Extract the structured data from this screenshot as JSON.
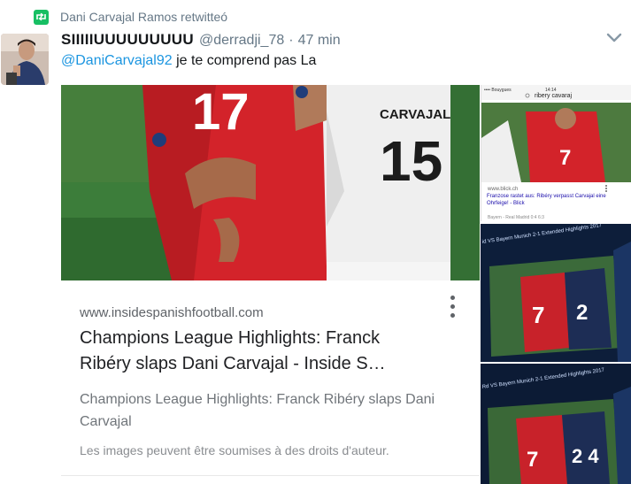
{
  "retweet": {
    "text": "Dani Carvajal Ramos retwitteó"
  },
  "tweet": {
    "name": "SIIIIIUUUUUUUUU",
    "handle": "@derradji_78",
    "separator": "·",
    "time": "47 min",
    "mention": "@DaniCarvajal92",
    "text": " je te comprend pas La"
  },
  "card": {
    "photo_jersey_number_left": "17",
    "photo_jersey_name": "CARVAJAL",
    "photo_jersey_number_right": "15",
    "site": "www.insidespanishfootball.com",
    "title": "Champions League Highlights: Franck Ribéry slaps Dani Carvajal - Inside S…",
    "description": "Champions League Highlights: Franck Ribéry slaps Dani Carvajal",
    "rights": "Les images peuvent être soumises à des droits d'auteur."
  },
  "thumb1": {
    "status_carrier": "•••• Bouygues",
    "status_time": "14:14",
    "search_query": "ribery cavaraj",
    "jersey_number": "7",
    "site": "www.blick.ch",
    "headline": "Franzose rastet aus: Ribéry verpasst Carvajal eine Ohrfeige! - Blick",
    "meta": "Bayern - Real Madrid 0:4 6:3"
  },
  "thumb2": {
    "banner": "id VS Bayern Munich 2-1 Extended Highlights 2017",
    "number_left": "7",
    "number_right": "2"
  },
  "thumb3": {
    "banner": "Rd VS Bayern Munich 2-1 Extended Highlights 2017",
    "number_left": "7",
    "number_right": "2 4"
  },
  "colors": {
    "accent_blue": "#1b95e0",
    "retweet_green": "#17bf63",
    "text_gray": "#657786"
  }
}
